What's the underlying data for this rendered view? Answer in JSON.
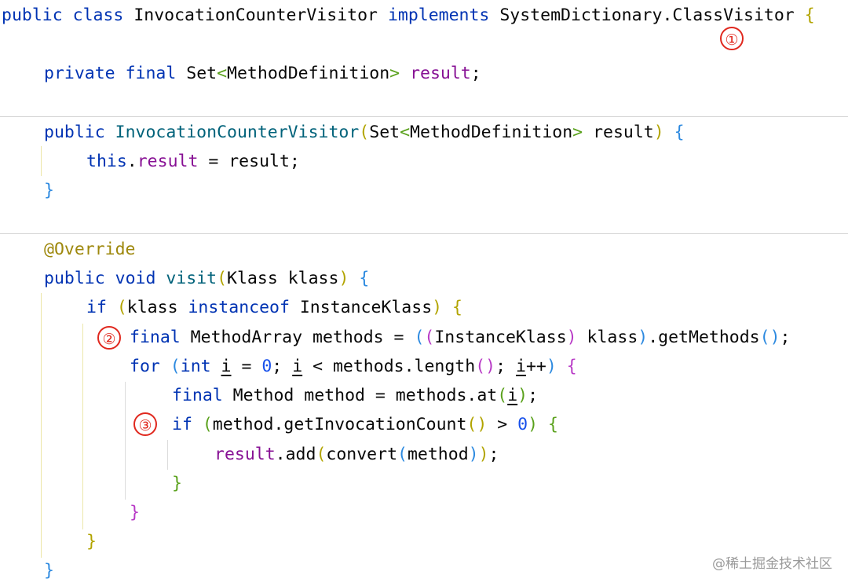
{
  "code": {
    "line1": {
      "kw1": "public",
      "kw2": "class",
      "name": "InvocationCounterVisitor",
      "kw3": "implements",
      "iface_a": "SystemDictionary",
      "iface_b": "ClassVisitor",
      "trail": "{"
    },
    "line2": {
      "kw1": "private",
      "kw2": "final",
      "type": "Set",
      "lt": "<",
      "generic": "MethodDefinition",
      "gt": ">",
      "field": "result",
      "semi": ";"
    },
    "line3": {
      "kw1": "public",
      "ctor": "InvocationCounterVisitor",
      "paren_open": "(",
      "type": "Set",
      "lt": "<",
      "generic": "MethodDefinition",
      "gt": ">",
      "param": "result",
      "paren_close": ")",
      "brace": "{"
    },
    "line4": {
      "kw": "this",
      "field": "result",
      "rest": " = result;"
    },
    "line5": {
      "brace": "}"
    },
    "line6": {
      "annotation": "@Override"
    },
    "line7": {
      "kw1": "public",
      "kw2": "void",
      "method": "visit",
      "paren_open": "(",
      "params": "Klass klass",
      "paren_close": ")",
      "brace": "{"
    },
    "line8": {
      "kw1": "if",
      "paren_open": "(",
      "left": "klass ",
      "kw2": "instanceof",
      "right": " InstanceKlass",
      "paren_close": ")",
      "brace": "{"
    },
    "line9": {
      "kw": "final",
      "decl": " MethodArray methods = ",
      "p1": "(",
      "p2": "(",
      "cast": "InstanceKlass",
      "p3": ")",
      "var": " klass",
      "p4": ")",
      "call": ".getMethods",
      "p5": "(",
      "p6": ")",
      "semi": ";"
    },
    "line10": {
      "kw1": "for",
      "paren_open": "(",
      "kw2": "int",
      "i1": "i",
      "mid1": " = ",
      "zero": "0",
      "mid2": "; ",
      "i2": "i",
      "mid3": " < methods.length",
      "p_a": "(",
      "p_b": ")",
      "mid4": "; ",
      "i3": "i",
      "inc": "++",
      "paren_close": ")",
      "brace": "{"
    },
    "line11": {
      "kw": "final",
      "decl": " Method method = methods.at",
      "p_open": "(",
      "i": "i",
      "p_close": ")",
      "semi": ";"
    },
    "line12": {
      "kw": "if",
      "paren_open": "(",
      "call": "method.getInvocationCount",
      "p_a": "(",
      "p_b": ")",
      "cmp": " > ",
      "zero": "0",
      "paren_close": ")",
      "brace": "{"
    },
    "line13": {
      "field": "result",
      "call": ".add",
      "p_open": "(",
      "inner": "convert",
      "p2_open": "(",
      "arg": "method",
      "p2_close": ")",
      "p_close": ")",
      "semi": ";"
    },
    "line14": {
      "brace": "}"
    },
    "line15": {
      "brace": "}"
    },
    "line16": {
      "brace": "}"
    },
    "line17": {
      "brace": "}"
    }
  },
  "markers": {
    "one": "①",
    "two": "②",
    "three": "③"
  },
  "watermark": "@稀土掘金技术社区"
}
